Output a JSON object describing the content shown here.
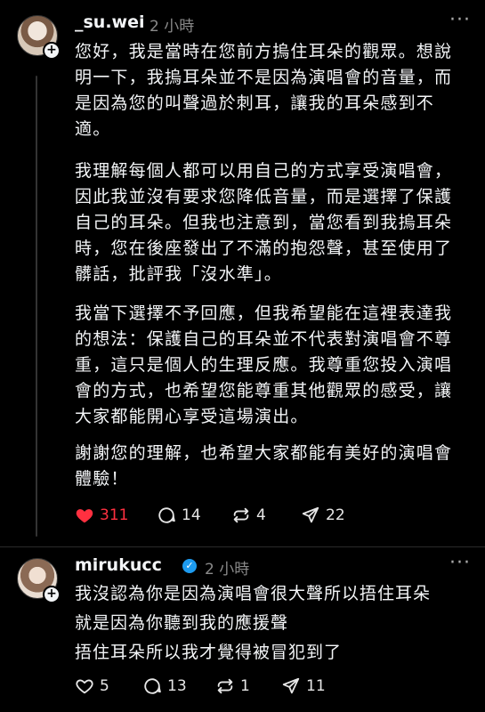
{
  "post": {
    "username": "_su.wei",
    "time": "2 小時",
    "paragraphs": [
      "您好，我是當時在您前方摀住耳朵的觀眾。想說明一下，我摀耳朵並不是因為演唱會的音量，而是因為您的叫聲過於刺耳，讓我的耳朵感到不適。",
      "我理解每個人都可以用自己的方式享受演唱會，因此我並沒有要求您降低音量，而是選擇了保護自己的耳朵。但我也注意到，當您看到我摀耳朵時，您在後座發出了不滿的抱怨聲，甚至使用了髒話，批評我「沒水準」。",
      "我當下選擇不予回應，但我希望能在這裡表達我的想法：保護自己的耳朵並不代表對演唱會不尊重，這只是個人的生理反應。我尊重您投入演唱會的方式，也希望您能尊重其他觀眾的感受，讓大家都能開心享受這場演出。",
      "謝謝您的理解，也希望大家都能有美好的演唱會體驗！"
    ],
    "likes": "311",
    "comments": "14",
    "reposts": "4",
    "shares": "22"
  },
  "reply": {
    "username": "mirukucc",
    "time": "2 小時",
    "lines": [
      "我沒認為你是因為演唱會很大聲所以捂住耳朵",
      "就是因為你聽到我的應援聲",
      "捂住耳朵所以我才覺得被冒犯到了"
    ],
    "likes": "5",
    "comments": "13",
    "reposts": "1",
    "shares": "11"
  },
  "colors": {
    "like_active": "#ff3040",
    "verified": "#1d9bf0"
  }
}
